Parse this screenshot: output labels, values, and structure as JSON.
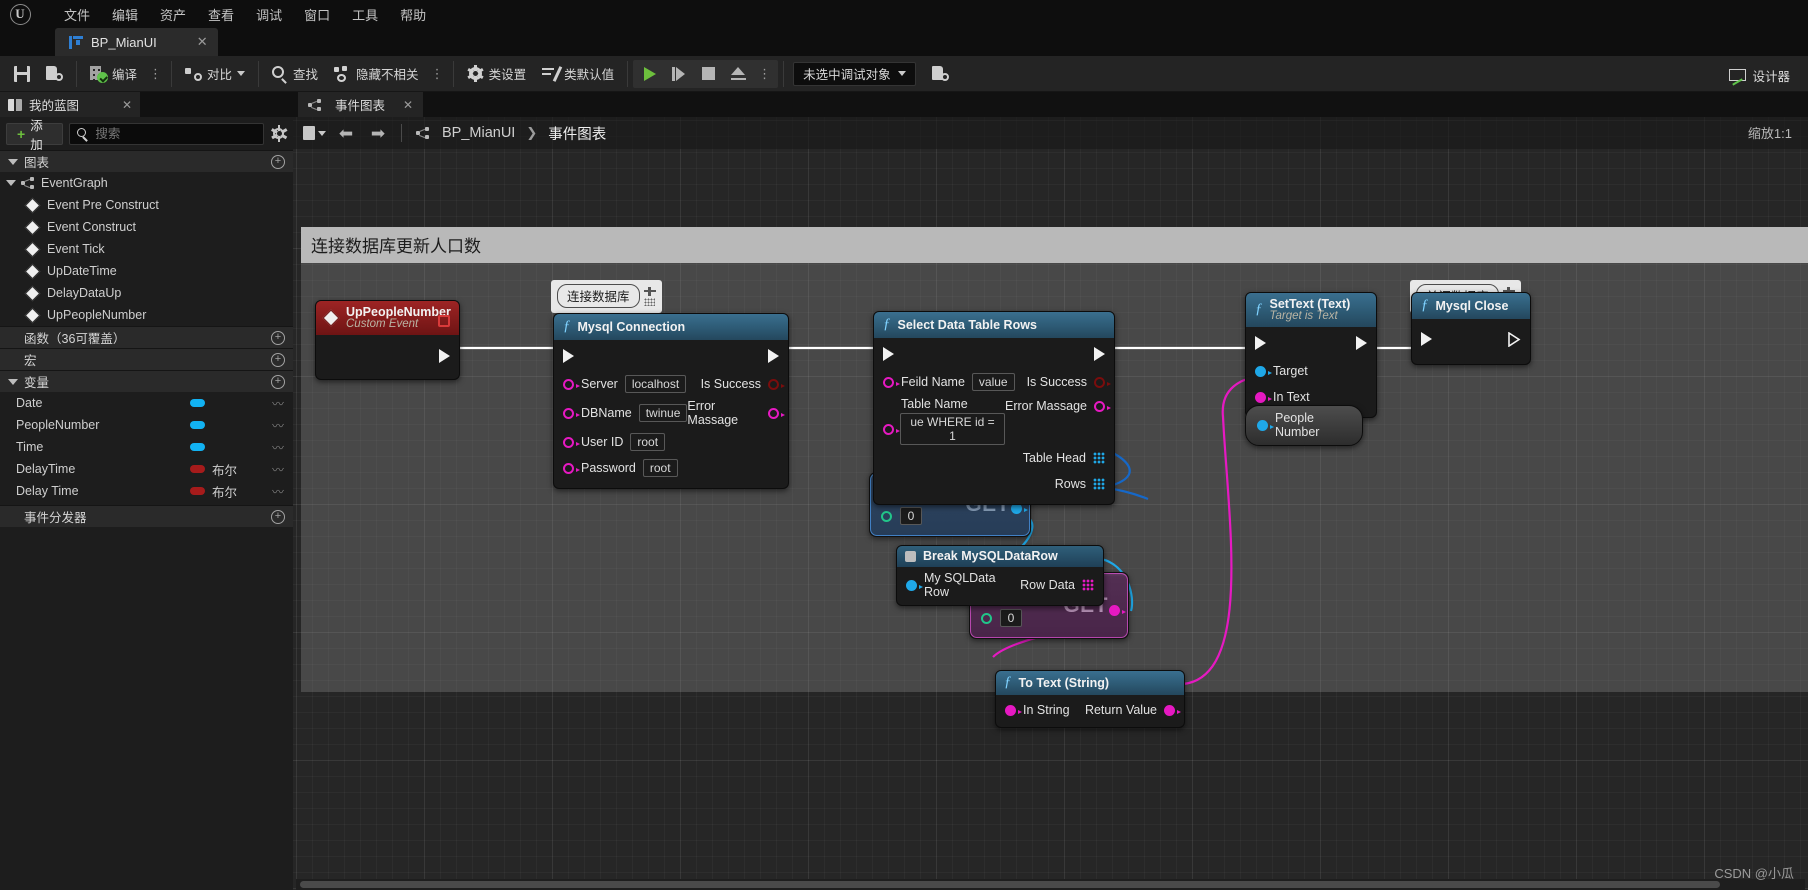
{
  "app": {
    "logo": "unreal-engine-logo",
    "menu": [
      "文件",
      "编辑",
      "资产",
      "查看",
      "调试",
      "窗口",
      "工具",
      "帮助"
    ],
    "asset_tab": {
      "label": "BP_MianUI",
      "close": "✕"
    }
  },
  "toolbar": {
    "save": "",
    "browse": "",
    "compile": "编译",
    "diff": "对比",
    "find": "查找",
    "hide_unrelated": "隐藏不相关",
    "class_settings": "类设置",
    "class_defaults": "类默认值",
    "debug_object": "未选中调试对象",
    "designer": "设计器",
    "dots": "⋮"
  },
  "left_panel": {
    "tab": {
      "label": "我的蓝图",
      "close": "✕"
    },
    "add_button": "添加",
    "search_placeholder": "搜索",
    "search_value": "",
    "sections": [
      {
        "label": "图表",
        "add": "+"
      },
      {
        "label": "函数（36可覆盖）",
        "add": "+"
      },
      {
        "label": "宏",
        "add": "+"
      },
      {
        "label": "变量",
        "add": "+"
      },
      {
        "label": "事件分发器",
        "add": "+"
      }
    ],
    "graph_root": "EventGraph",
    "events": [
      "Event Pre Construct",
      "Event Construct",
      "Event Tick",
      "UpDateTime",
      "DelayDataUp",
      "UpPeopleNumber"
    ],
    "variables": [
      {
        "name": "Date",
        "type": "",
        "color": "blue"
      },
      {
        "name": "PeopleNumber",
        "type": "",
        "color": "blue"
      },
      {
        "name": "Time",
        "type": "",
        "color": "blue"
      },
      {
        "name": "DelayTime",
        "type": "布尔",
        "color": "red"
      },
      {
        "name": "Delay Time",
        "type": "布尔",
        "color": "red"
      }
    ]
  },
  "graph": {
    "tab": {
      "label": "事件图表",
      "close": "✕"
    },
    "breadcrumb": {
      "root": "BP_MianUI",
      "sep": "❯",
      "current": "事件图表"
    },
    "zoom": "缩放1:1",
    "watermark": "CSDN @小瓜",
    "comment": "连接数据库更新人口数",
    "bubbles": [
      {
        "id": "connect-db-bubble",
        "text": "连接数据库"
      },
      {
        "id": "close-db-bubble",
        "text": "关闭数据库"
      }
    ],
    "nodes": {
      "custom_event": {
        "title": "UpPeopleNumber",
        "subtitle": "Custom Event"
      },
      "mysql_connection": {
        "title": "Mysql Connection",
        "inputs": [
          {
            "label": "Server",
            "value": "localhost"
          },
          {
            "label": "DBName",
            "value": "twinue"
          },
          {
            "label": "User ID",
            "value": "root"
          },
          {
            "label": "Password",
            "value": "root"
          }
        ],
        "outputs": [
          {
            "label": "Is Success"
          },
          {
            "label": "Error Massage"
          }
        ]
      },
      "select_data_table_rows": {
        "title": "Select Data Table Rows",
        "inputs": [
          {
            "label": "Feild Name",
            "value": "value"
          },
          {
            "label": "Table Name",
            "value": "ue WHERE id = 1"
          }
        ],
        "outputs": [
          {
            "label": "Is Success"
          },
          {
            "label": "Error Massage"
          },
          {
            "label": "Table Head"
          },
          {
            "label": "Rows"
          }
        ]
      },
      "get_rows": {
        "label": "GET",
        "index": "0"
      },
      "break_row": {
        "title": "Break MySQLDataRow",
        "input": "My SQLData Row",
        "output": "Row Data"
      },
      "get_row_data": {
        "label": "GET",
        "index": "0"
      },
      "to_text_string": {
        "title": "To Text (String)",
        "input": "In String",
        "output": "Return Value"
      },
      "set_text": {
        "title": "SetText (Text)",
        "subtitle": "Target is Text",
        "inputs": [
          {
            "label": "Target"
          },
          {
            "label": "In Text"
          }
        ]
      },
      "people_number": {
        "label": "People Number"
      },
      "mysql_close": {
        "title": "Mysql Close"
      }
    }
  },
  "colors": {
    "accent_blue": "#2e7fd4",
    "exec_white": "#f2f2f2",
    "string_pin": "#e619c2",
    "bool_pin": "#a61b1b",
    "object_pin": "#1fa8e8",
    "compile_green": "#5fc24a",
    "node_header_fn": "#2d5a74",
    "node_header_event": "#8f2020"
  }
}
